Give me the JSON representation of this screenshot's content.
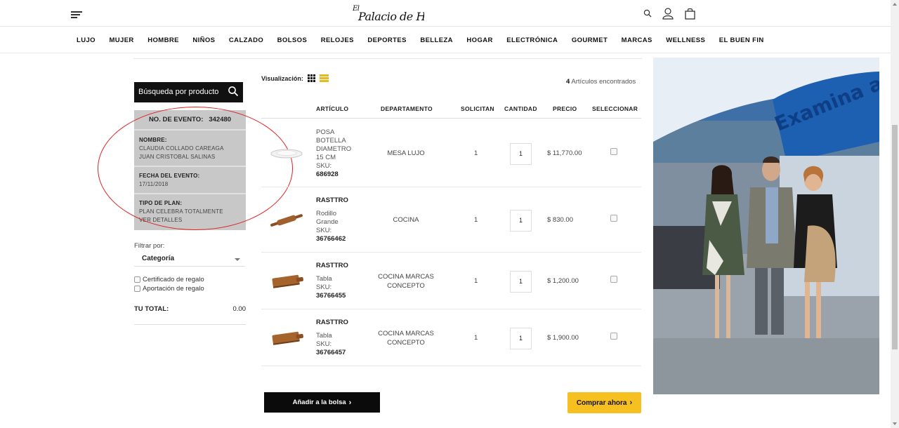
{
  "brand": {
    "logo_text": "El Palacio de Hierro"
  },
  "header": {
    "icons": [
      "menu-icon",
      "search-icon",
      "user-icon",
      "bag-icon"
    ]
  },
  "nav": {
    "items": [
      "LUJO",
      "MUJER",
      "HOMBRE",
      "NIÑOS",
      "CALZADO",
      "BOLSOS",
      "RELOJES",
      "DEPORTES",
      "BELLEZA",
      "HOGAR",
      "ELECTRÓNICA",
      "GOURMET",
      "MARCAS",
      "WELLNESS",
      "EL BUEN FIN"
    ]
  },
  "sidebar": {
    "search_label": "Búsqueda por producto",
    "event_number_label": "NO. DE EVENTO:",
    "event_number": "342480",
    "name_label": "NOMBRE:",
    "name_line1": "CLAUDIA COLLADO CAREAGA",
    "name_line2": "JUAN CRISTOBAL SALINAS",
    "date_label": "FECHA DEL EVENTO:",
    "date_value": "17/11/2018",
    "plan_label": "TIPO DE PLAN:",
    "plan_value": "PLAN CELEBRA TOTALMENTE",
    "plan_details": "VER DETALLES",
    "filter_label": "Filtrar por:",
    "filter_value": "Categoría",
    "checkbox_1": "Certificado de regalo",
    "checkbox_2": "Aportación de regalo",
    "total_label": "TU TOTAL:",
    "total_value": "0.00"
  },
  "main": {
    "view_label": "Visualización:",
    "found_count": "4",
    "found_text": "Artículos encontrados",
    "columns": {
      "article": "ARTÍCULO",
      "department": "DEPARTAMENTO",
      "requested": "SOLICITAN",
      "quantity": "CANTIDAD",
      "price": "PRECIO",
      "select": "SELECCIONAR"
    },
    "rows": [
      {
        "brand": "",
        "name_lines": [
          "POSA",
          "BOTELLA",
          "DIAMETRO",
          "15 CM"
        ],
        "sku_label": "SKU:",
        "sku": "686928",
        "department_lines": [
          "MESA LUJO",
          ""
        ],
        "requested": "1",
        "quantity": "1",
        "price": "$ 11,770.00",
        "image": "plate-image"
      },
      {
        "brand": "RASTTRO",
        "name_lines": [
          "Rodillo",
          "Grande"
        ],
        "sku_label": "SKU:",
        "sku": "36766462",
        "department_lines": [
          "COCINA",
          ""
        ],
        "requested": "1",
        "quantity": "1",
        "price": "$ 830.00",
        "image": "rolling-pin-image"
      },
      {
        "brand": "RASTTRO",
        "name_lines": [
          "Tabla"
        ],
        "sku_label": "SKU:",
        "sku": "36766455",
        "department_lines": [
          "COCINA MARCAS",
          "CONCEPTO"
        ],
        "requested": "1",
        "quantity": "1",
        "price": "$ 1,200.00",
        "image": "cutting-board-image"
      },
      {
        "brand": "RASTTRO",
        "name_lines": [
          "Tabla"
        ],
        "sku_label": "SKU:",
        "sku": "36766457",
        "department_lines": [
          "COCINA MARCAS",
          "CONCEPTO"
        ],
        "requested": "1",
        "quantity": "1",
        "price": "$ 1,900.00",
        "image": "cutting-board-image"
      }
    ],
    "add_to_bag": "Añadir a la bolsa",
    "buy_now": "Comprar ahora"
  },
  "photo": {
    "sign_text": "Examina al p"
  },
  "colors": {
    "accent": "#f6c020",
    "dark": "#0b0b0b",
    "panel": "#c8c8c8",
    "annotation": "#e02020"
  }
}
